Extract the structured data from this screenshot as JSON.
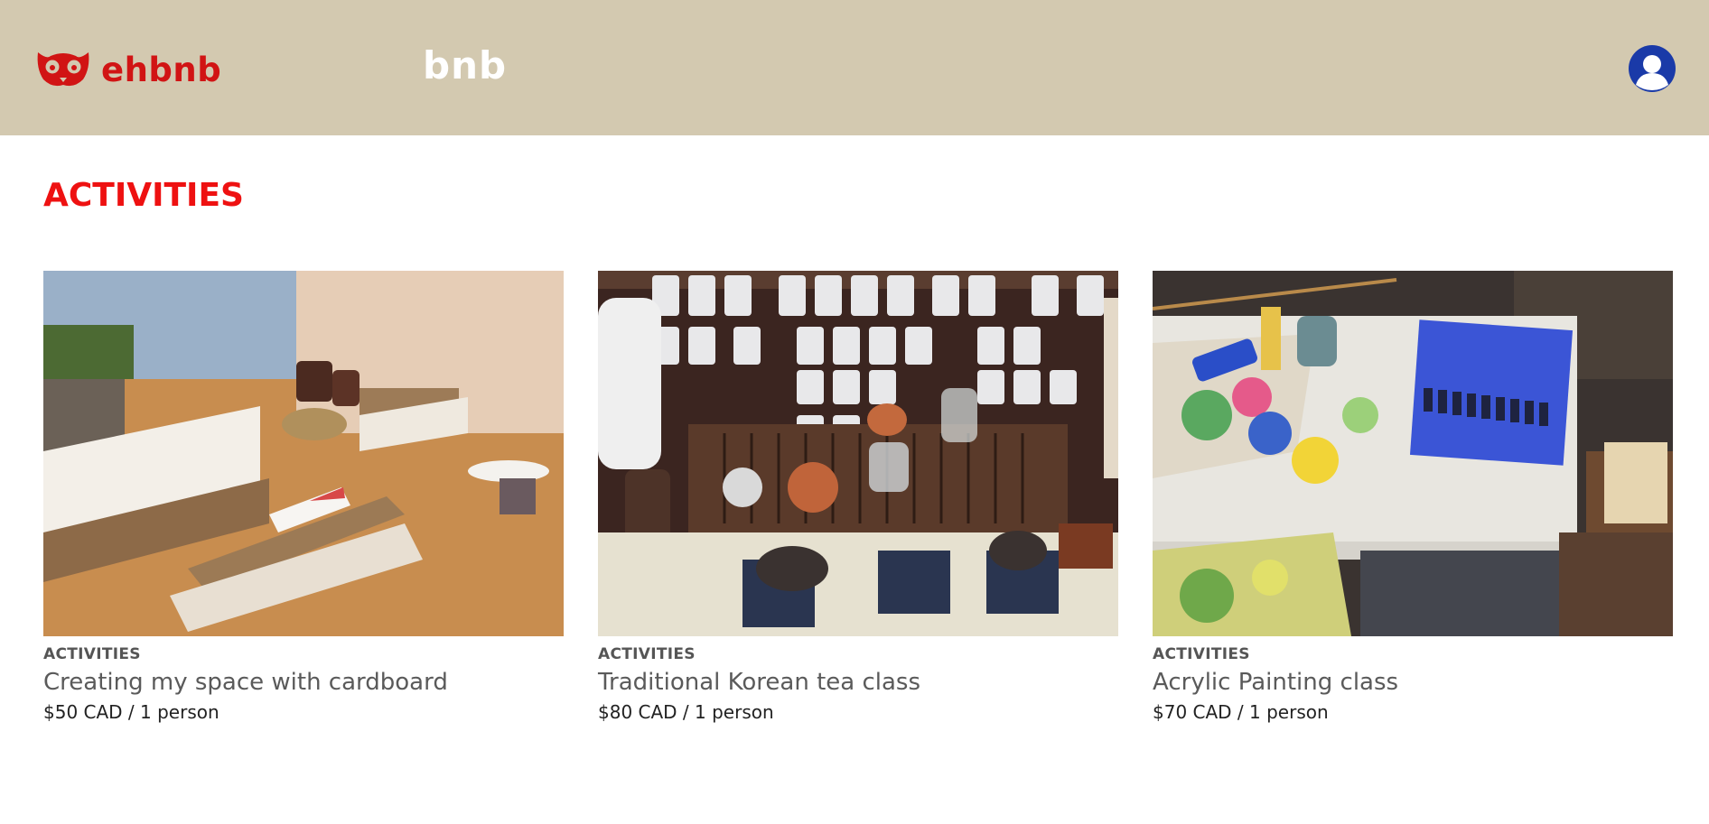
{
  "header": {
    "logo_text": "ehbnb",
    "center_title": "bnb",
    "logo_icon": "owl-glasses-icon",
    "avatar_icon": "user-avatar-icon",
    "logo_color": "#d11414",
    "bg_color": "#d3c9b0"
  },
  "main": {
    "section_title": "ACTIVITIES",
    "section_color": "#ee1111",
    "cards": [
      {
        "category": "ACTIVITIES",
        "title": "Creating my space with cardboard",
        "price": "$50 CAD / 1 person",
        "image": "cardboard-furniture-photo"
      },
      {
        "category": "ACTIVITIES",
        "title": "Traditional Korean tea class",
        "price": "$80 CAD / 1 person",
        "image": "tea-set-photo"
      },
      {
        "category": "ACTIVITIES",
        "title": "Acrylic Painting class",
        "price": "$70 CAD / 1 person",
        "image": "acrylic-painting-photo"
      }
    ]
  }
}
